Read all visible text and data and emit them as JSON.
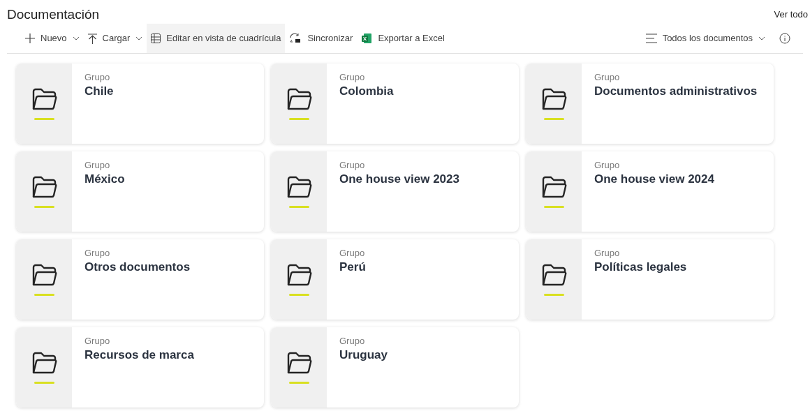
{
  "header": {
    "title": "Documentación",
    "link": "Ver todo"
  },
  "toolbar": [
    {
      "kind": "plus",
      "label": "Nuevo",
      "dropdown": true,
      "highlighted": false
    },
    {
      "kind": "upload",
      "label": "Cargar",
      "dropdown": true,
      "highlighted": false
    },
    {
      "kind": "grid",
      "label": "Editar en vista de cuadrícula",
      "dropdown": false,
      "highlighted": true
    },
    {
      "kind": "sync",
      "label": "Sincronizar",
      "dropdown": false,
      "highlighted": false
    },
    {
      "kind": "excel",
      "label": "Exportar a Excel",
      "dropdown": false,
      "highlighted": false
    }
  ],
  "view": {
    "label": "Todos los documentos"
  },
  "cards": [
    {
      "type": "Grupo",
      "name": "Chile"
    },
    {
      "type": "Grupo",
      "name": "Colombia"
    },
    {
      "type": "Grupo",
      "name": "Documentos administrativos"
    },
    {
      "type": "Grupo",
      "name": "México"
    },
    {
      "type": "Grupo",
      "name": "One house view 2023"
    },
    {
      "type": "Grupo",
      "name": "One house view 2024"
    },
    {
      "type": "Grupo",
      "name": "Otros documentos"
    },
    {
      "type": "Grupo",
      "name": "Perú"
    },
    {
      "type": "Grupo",
      "name": "Políticas legales"
    },
    {
      "type": "Grupo",
      "name": "Recursos de marca"
    },
    {
      "type": "Grupo",
      "name": "Uruguay"
    }
  ]
}
